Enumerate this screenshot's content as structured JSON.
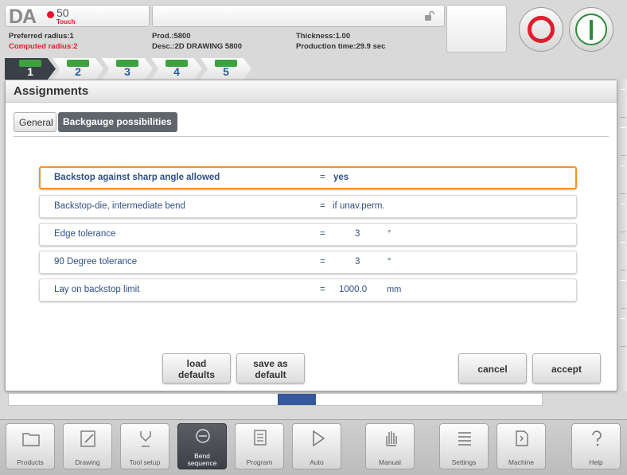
{
  "brand": {
    "logo": "DA",
    "model": "50",
    "touch": "Touch"
  },
  "header": {
    "preferred_radius": "Preferred radius:1",
    "computed_radius": "Computed radius:2",
    "prod": "Prod.:5800",
    "desc": "Desc.:2D DRAWING 5800",
    "thickness": "Thickness:1.00",
    "production_time": "Production time:29.9 sec"
  },
  "steps": [
    "1",
    "2",
    "3",
    "4",
    "5"
  ],
  "panel": {
    "title": "Assignments",
    "tabs": {
      "general": "General",
      "backgauge": "Backgauge possibilities"
    }
  },
  "rows": [
    {
      "label": "Backstop against sharp angle allowed",
      "eq": "=",
      "value": "yes",
      "unit": ""
    },
    {
      "label": "Backstop-die, intermediate bend",
      "eq": "=",
      "value": "if unav.perm.",
      "unit": ""
    },
    {
      "label": "Edge tolerance",
      "eq": "=",
      "value": "3",
      "unit": "°"
    },
    {
      "label": "90 Degree tolerance",
      "eq": "=",
      "value": "3",
      "unit": "°"
    },
    {
      "label": "Lay on backstop limit",
      "eq": "=",
      "value": "1000.0",
      "unit": "mm"
    }
  ],
  "buttons": {
    "load_defaults_1": "load",
    "load_defaults_2": "defaults",
    "save_default_1": "save as",
    "save_default_2": "default",
    "cancel": "cancel",
    "accept": "accept"
  },
  "toolbar": {
    "products": "Products",
    "drawing": "Drawing",
    "tool_setup": "Tool setup",
    "bend_sequence_1": "Bend",
    "bend_sequence_2": "sequence",
    "program": "Program",
    "auto": "Auto",
    "manual": "Manual",
    "settings": "Settings",
    "machine": "Machine",
    "help": "Help"
  },
  "colors": {
    "accent_orange": "#ee9626",
    "stop_red": "#e21d2c",
    "start_green": "#2d8a3a",
    "text_blue": "#2f4f87",
    "step_glyph_green": "#3da23f"
  }
}
